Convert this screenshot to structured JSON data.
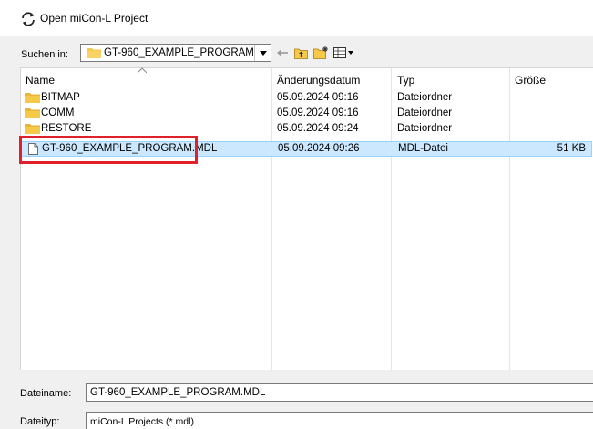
{
  "window": {
    "title": "Open miCon-L Project",
    "title_icon": "refresh-arrows-icon"
  },
  "look_in": {
    "label": "Suchen in:",
    "value": "GT-960_EXAMPLE_PROGRAM"
  },
  "toolbar": {
    "back_icon": "back-arrow-icon",
    "up_icon": "up-folder-icon",
    "new_folder_icon": "new-folder-icon",
    "view_icon": "view-menu-icon"
  },
  "columns": {
    "name": "Name",
    "modified": "Änderungsdatum",
    "type": "Typ",
    "size": "Größe"
  },
  "files": [
    {
      "name": "BITMAP",
      "modified": "05.09.2024 09:16",
      "type": "Dateiordner",
      "size": "",
      "kind": "folder"
    },
    {
      "name": "COMM",
      "modified": "05.09.2024 09:16",
      "type": "Dateiordner",
      "size": "",
      "kind": "folder"
    },
    {
      "name": "RESTORE",
      "modified": "05.09.2024 09:24",
      "type": "Dateiordner",
      "size": "",
      "kind": "folder"
    },
    {
      "name": "GT-960_EXAMPLE_PROGRAM.MDL",
      "modified": "05.09.2024 09:26",
      "type": "MDL-Datei",
      "size": "51 KB",
      "kind": "file"
    }
  ],
  "filename": {
    "label": "Dateiname:",
    "value": "GT-960_EXAMPLE_PROGRAM.MDL"
  },
  "filetype": {
    "label": "Dateityp:",
    "value": "miCon-L Projects (*.mdl)"
  },
  "colors": {
    "selection": "#cce8ff",
    "highlight": "#e0202a",
    "folder": "#f7c948"
  }
}
